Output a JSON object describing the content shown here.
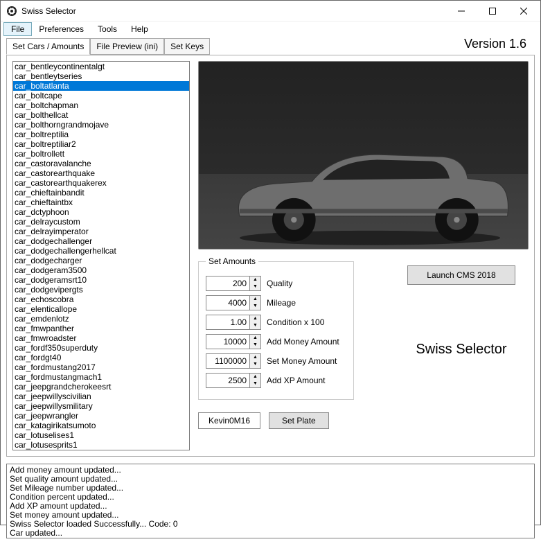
{
  "window": {
    "title": "Swiss Selector"
  },
  "menu": {
    "file": "File",
    "preferences": "Preferences",
    "tools": "Tools",
    "help": "Help",
    "active": "File"
  },
  "tabs": {
    "set_cars": "Set Cars / Amounts",
    "file_preview": "File Preview (ini)",
    "set_keys": "Set Keys",
    "active": "set_cars"
  },
  "version_label": "Version 1.6",
  "car_list": {
    "selected_index": 2,
    "items": [
      "car_bentleycontinentalgt",
      "car_bentleytseries",
      "car_boltatlanta",
      "car_boltcape",
      "car_boltchapman",
      "car_bolthellcat",
      "car_bolthorngrandmojave",
      "car_boltreptilia",
      "car_boltreptiliar2",
      "car_boltrollett",
      "car_castoravalanche",
      "car_castorearthquake",
      "car_castorearthquakerex",
      "car_chieftainbandit",
      "car_chieftaintbx",
      "car_dctyphoon",
      "car_delraycustom",
      "car_delrayimperator",
      "car_dodgechallenger",
      "car_dodgechallengerhellcat",
      "car_dodgecharger",
      "car_dodgeram3500",
      "car_dodgeramsrt10",
      "car_dodgevipergts",
      "car_echoscobra",
      "car_elenticallope",
      "car_emdenlotz",
      "car_fmwpanther",
      "car_fmwroadster",
      "car_fordf350superduty",
      "car_fordgt40",
      "car_fordmustang2017",
      "car_fordmustangmach1",
      "car_jeepgrandcherokeesrt",
      "car_jeepwillyscivilian",
      "car_jeepwillysmilitary",
      "car_jeepwrangler",
      "car_katagirikatsumoto",
      "car_lotuselises1",
      "car_lotusesprits1"
    ]
  },
  "amounts": {
    "legend": "Set Amounts",
    "quality": {
      "value": "200",
      "label": "Quality"
    },
    "mileage": {
      "value": "4000",
      "label": "Mileage"
    },
    "condition": {
      "value": "1.00",
      "label": "Condition x 100"
    },
    "add_money": {
      "value": "10000",
      "label": "Add Money Amount"
    },
    "set_money": {
      "value": "1100000",
      "label": "Set Money Amount"
    },
    "add_xp": {
      "value": "2500",
      "label": "Add XP Amount"
    }
  },
  "plate": {
    "value": "Kevin0M16",
    "button": "Set Plate"
  },
  "launch_button": "Launch CMS 2018",
  "brand": "Swiss Selector",
  "log": [
    "Add money amount updated...",
    "Set quality amount updated...",
    "Set Mileage number updated...",
    "Condition percent updated...",
    "Add XP amount updated...",
    "Set money amount updated...",
    "Swiss Selector loaded Successfully... Code: 0",
    "Car updated..."
  ]
}
